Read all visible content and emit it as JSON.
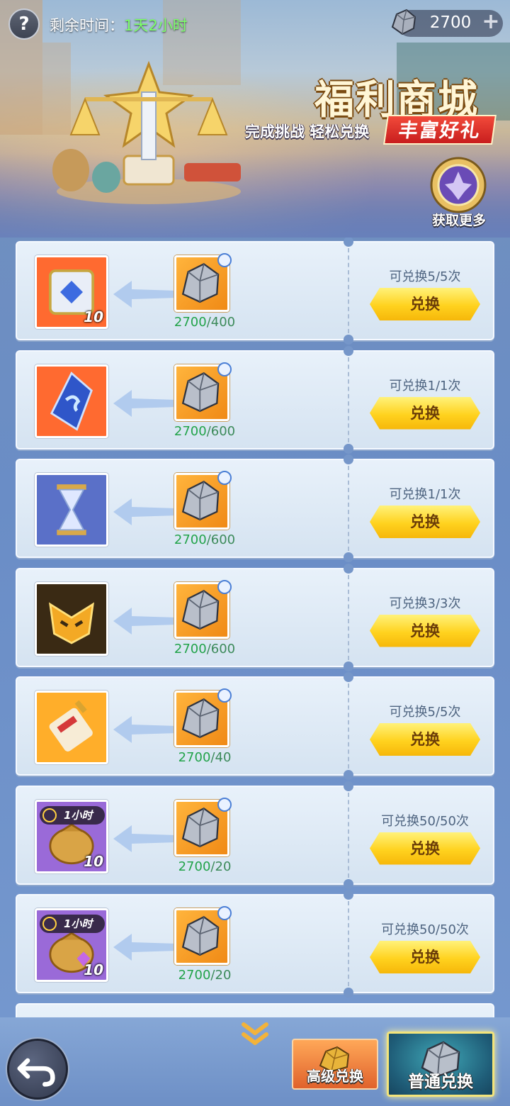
{
  "header": {
    "help_icon": "question-mark-icon",
    "time_label": "剩余时间：",
    "time_value": "1天2小时",
    "currency_icon": "ore-stone-icon",
    "currency_value": "2700",
    "plus_icon": "plus-icon"
  },
  "banner": {
    "title": "福利商城",
    "subtitle": "完成挑战 轻松兑换",
    "badge": "丰富好礼",
    "more_label": "获取更多"
  },
  "items": [
    {
      "reward_icon": "gem-cube-icon",
      "reward_count": "10",
      "reward_time": "",
      "cost_have": "2700",
      "cost_need": "/400",
      "limit": "可兑换5/5次",
      "button": "兑换",
      "frame": "#ff6a30"
    },
    {
      "reward_icon": "blue-crystal-icon",
      "reward_count": "",
      "reward_time": "",
      "cost_have": "2700",
      "cost_need": "/600",
      "limit": "可兑换1/1次",
      "button": "兑换",
      "frame": "#ff6a30"
    },
    {
      "reward_icon": "hourglass-icon",
      "reward_count": "",
      "reward_time": "",
      "cost_have": "2700",
      "cost_need": "/600",
      "limit": "可兑换1/1次",
      "button": "兑换",
      "frame": "#5a70c8"
    },
    {
      "reward_icon": "golden-mask-icon",
      "reward_count": "",
      "reward_time": "",
      "cost_have": "2700",
      "cost_need": "/600",
      "limit": "可兑换3/3次",
      "button": "兑换",
      "frame": "#3a2a14"
    },
    {
      "reward_icon": "scroll-icon",
      "reward_count": "",
      "reward_time": "",
      "cost_have": "2700",
      "cost_need": "/40",
      "limit": "可兑换5/5次",
      "button": "兑换",
      "frame": "#ffae2a"
    },
    {
      "reward_icon": "gold-bag-icon",
      "reward_count": "10",
      "reward_time": "1小时",
      "cost_have": "2700",
      "cost_need": "/20",
      "limit": "可兑换50/50次",
      "button": "兑换",
      "frame": "#9a6ad8"
    },
    {
      "reward_icon": "exp-bag-icon",
      "reward_count": "10",
      "reward_time": "1小时",
      "cost_have": "2700",
      "cost_need": "/20",
      "limit": "可兑换50/50次",
      "button": "兑换",
      "frame": "#9a6ad8"
    }
  ],
  "footer": {
    "back_icon": "back-arrow-icon",
    "scroll_more_icon": "chevron-double-down-icon",
    "tab_advanced": "高级兑换",
    "tab_normal": "普通兑换"
  }
}
